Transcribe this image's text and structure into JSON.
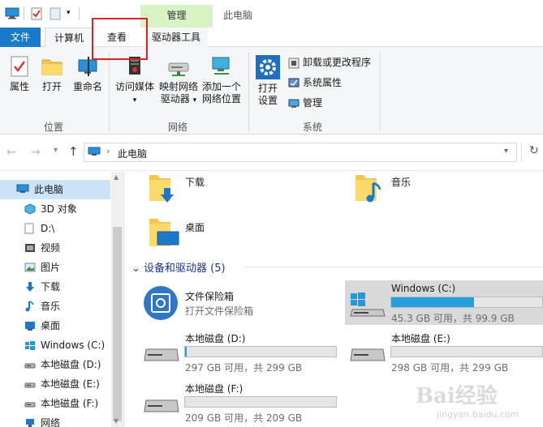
{
  "titlebar": {
    "manage": "管理",
    "title": "此电脑"
  },
  "tabs": {
    "file": "文件",
    "computer": "计算机",
    "view": "查看",
    "drive_tools": "驱动器工具"
  },
  "ribbon": {
    "location": {
      "label": "位置",
      "properties": "属性",
      "open": "打开",
      "rename": "重命名"
    },
    "network": {
      "label": "网络",
      "media_line1": "访问媒体",
      "map_line1": "映射网络",
      "map_line2": "驱动器",
      "add_line1": "添加一个",
      "add_line2": "网络位置"
    },
    "system": {
      "label": "系统",
      "open_line1": "打开",
      "open_line2": "设置",
      "uninstall": "卸载或更改程序",
      "sys_props": "系统属性",
      "manage": "管理"
    }
  },
  "address": {
    "path": "此电脑"
  },
  "sidebar": {
    "items": [
      {
        "label": "此电脑"
      },
      {
        "label": "3D 对象"
      },
      {
        "label": "D:\\"
      },
      {
        "label": "视频"
      },
      {
        "label": "图片"
      },
      {
        "label": "下载"
      },
      {
        "label": "音乐"
      },
      {
        "label": "桌面"
      },
      {
        "label": "Windows (C:)"
      },
      {
        "label": "本地磁盘 (D:)"
      },
      {
        "label": "本地磁盘 (E:)"
      },
      {
        "label": "本地磁盘 (F:)"
      },
      {
        "label": "网络"
      }
    ]
  },
  "folders": [
    {
      "label": "下载"
    },
    {
      "label": "音乐"
    },
    {
      "label": "桌面"
    }
  ],
  "devices": {
    "header": "设备和驱动器 (5)",
    "vault": {
      "name": "文件保险箱",
      "sub": "打开文件保险箱"
    },
    "drives": [
      {
        "name": "Windows (C:)",
        "free": "45.3 GB 可用，共 99.9 GB",
        "used_fraction": 0.55
      },
      {
        "name": "本地磁盘 (D:)",
        "free": "297 GB 可用，共 299 GB",
        "used_fraction": 0.01
      },
      {
        "name": "本地磁盘 (E:)",
        "free": "298 GB 可用，共 299 GB",
        "used_fraction": 0.0
      },
      {
        "name": "本地磁盘 (F:)",
        "free": "209 GB 可用，共 209 GB",
        "used_fraction": 0.0
      }
    ]
  },
  "watermark": {
    "brand": "Bai经验",
    "url": "jingyan.baidu.com"
  },
  "colors": {
    "accent": "#1979ca",
    "manage_context": "#d8f3c4",
    "selection": "#cce4f7",
    "highlight_box": "#e01f26",
    "drive_fill": "#26a0da"
  }
}
